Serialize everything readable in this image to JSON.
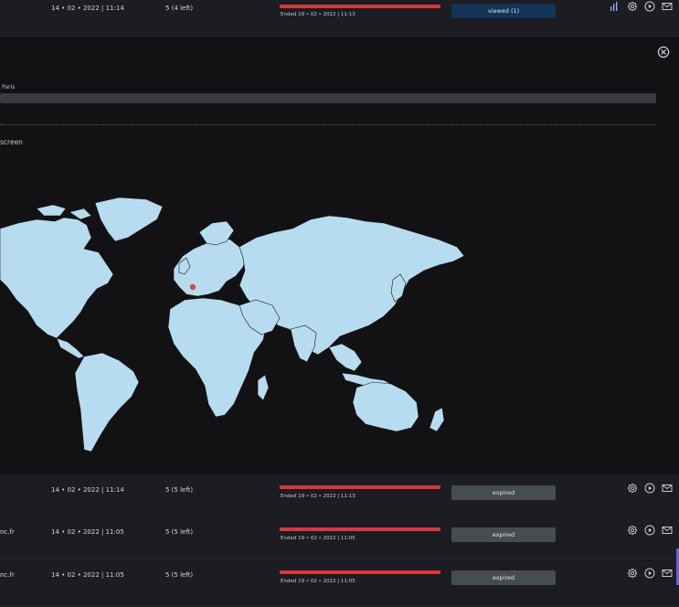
{
  "top_row": {
    "date": "14 • 02 • 2022 | 11:14",
    "count": "5 (4 left)",
    "ended": "Ended 19 • 02 • 2022 | 11:13",
    "status": "viewed (1)"
  },
  "panel": {
    "city_label": "Paris",
    "screen_label": "screen"
  },
  "rows": [
    {
      "name": "",
      "date": "14 • 02 • 2022 | 11:14",
      "count": "5 (5 left)",
      "ended": "Ended 19 • 02 • 2022 | 11:13",
      "status": "expired"
    },
    {
      "name": "nc.fr",
      "date": "14 • 02 • 2022 | 11:05",
      "count": "5 (5 left)",
      "ended": "Ended 19 • 02 • 2022 | 11:05",
      "status": "expired"
    },
    {
      "name": "nc.fr",
      "date": "14 • 02 • 2022 | 11:05",
      "count": "5 (5 left)",
      "ended": "Ended 19 • 02 • 2022 | 11:05",
      "status": "expired"
    }
  ],
  "icons": [
    "stats-icon",
    "settings-icon",
    "play-icon",
    "email-icon",
    "trash-icon",
    "close-icon"
  ],
  "colors": {
    "progress": "#d23b3b",
    "viewed": "#143457",
    "expired": "#464d50",
    "map_land": "#b8dcef",
    "map_marker": "#d24a4a"
  }
}
